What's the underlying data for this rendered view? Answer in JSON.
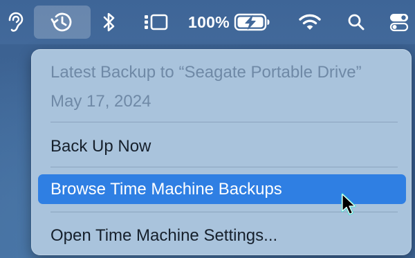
{
  "menubar": {
    "battery_percent": "100%",
    "icons": [
      "hearing-icon",
      "time-machine-icon",
      "bluetooth-icon",
      "stage-manager-icon",
      "battery-charging-icon",
      "wifi-icon",
      "search-icon",
      "control-center-icon"
    ]
  },
  "menu": {
    "latest_backup_label": "Latest Backup to “Seagate Portable Drive”",
    "latest_backup_date": "May 17, 2024",
    "items": [
      {
        "label": "Back Up Now"
      },
      {
        "label": "Browse Time Machine Backups"
      },
      {
        "label": "Open Time Machine Settings..."
      }
    ]
  },
  "colors": {
    "highlight": "#2f7fe3",
    "menu_background": "#a9c3dc",
    "menubar_background": "#3e6597"
  }
}
